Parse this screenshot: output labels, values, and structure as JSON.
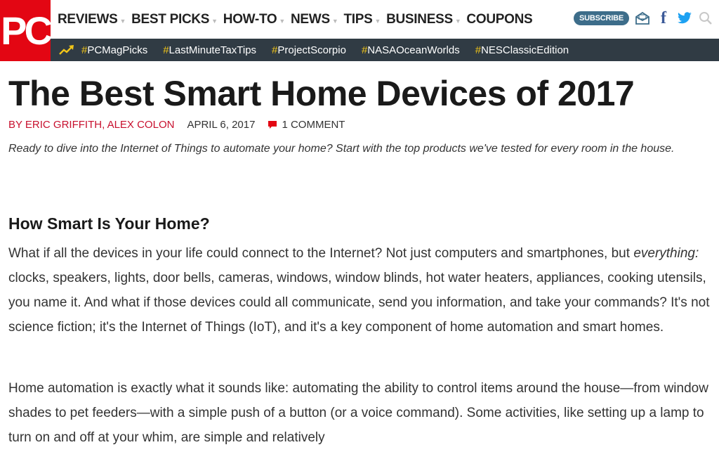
{
  "logo": {
    "text": "PC"
  },
  "nav": {
    "items": [
      {
        "label": "REVIEWS",
        "dropdown": true
      },
      {
        "label": "BEST PICKS",
        "dropdown": true
      },
      {
        "label": "HOW-TO",
        "dropdown": true
      },
      {
        "label": "NEWS",
        "dropdown": true
      },
      {
        "label": "TIPS",
        "dropdown": true
      },
      {
        "label": "BUSINESS",
        "dropdown": true
      },
      {
        "label": "COUPONS",
        "dropdown": false
      }
    ]
  },
  "social": {
    "subscribe_label": "SUBSCRIBE",
    "icons": [
      "newsletter-icon",
      "facebook-icon",
      "twitter-icon",
      "search-icon"
    ],
    "colors": {
      "subscribe": "#3d6d8a",
      "facebook": "#3b5998",
      "twitter": "#1da1f2"
    }
  },
  "trending": {
    "icon": "trending-icon",
    "tags": [
      {
        "hash": "#",
        "text": "PCMagPicks"
      },
      {
        "hash": "#",
        "text": "LastMinuteTaxTips"
      },
      {
        "hash": "#",
        "text": "ProjectScorpio"
      },
      {
        "hash": "#",
        "text": "NASAOceanWorlds"
      },
      {
        "hash": "#",
        "text": "NESClassicEdition"
      }
    ]
  },
  "article": {
    "title": "The Best Smart Home Devices of 2017",
    "authors": "BY ERIC GRIFFITH, ALEX COLON",
    "date": "APRIL 6, 2017",
    "comments": "1 COMMENT",
    "deck": "Ready to dive into the Internet of Things to automate your home? Start with the top products we've tested for every room in the house.",
    "section_heading": "How Smart Is Your Home?",
    "p1_before": "What if all the devices in your life could connect to the Internet? Not just computers and smartphones, but ",
    "p1_em": "everything:",
    "p1_after": " clocks, speakers, lights, door bells, cameras, windows, window blinds, hot water heaters, appliances, cooking utensils, you name it. And what if those devices could all communicate, send you information, and take your commands? It's not science fiction; it's the Internet of Things (IoT), and it's a key component of home automation and smart homes.",
    "p2": "Home automation is exactly what it sounds like: automating the ability to control items around the house—from window shades to pet feeders—with a simple push of a button (or a voice command). Some activities, like setting up a lamp to turn on and off at your whim, are simple and relatively"
  },
  "colors": {
    "brand_red": "#e30613",
    "trending_bar": "#303b44",
    "hashtag": "#f0c419",
    "author": "#c8102e"
  }
}
